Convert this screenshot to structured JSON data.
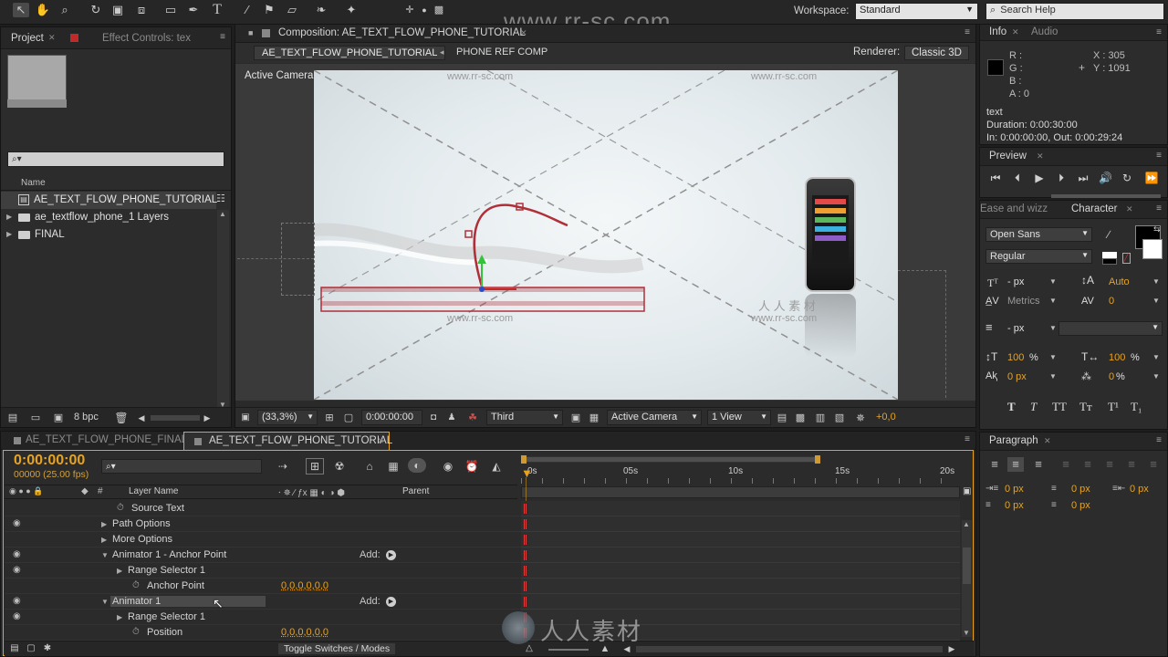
{
  "toolbar": {
    "workspace_label": "Workspace:",
    "workspace_value": "Standard",
    "search_placeholder": "Search Help"
  },
  "watermark": "www.rr-sc.com",
  "project_panel": {
    "tab_project": "Project",
    "tab_effect_controls": "Effect Controls: tex",
    "column_name": "Name",
    "items": [
      {
        "label": "AE_TEXT_FLOW_PHONE_TUTORIAL",
        "type": "composition"
      },
      {
        "label": "ae_textflow_phone_1 Layers",
        "type": "folder"
      },
      {
        "label": "FINAL",
        "type": "folder"
      }
    ],
    "bpc": "8 bpc"
  },
  "composition_panel": {
    "tab_title": "Composition: AE_TEXT_FLOW_PHONE_TUTORIAL",
    "breadcrumb_current": "AE_TEXT_FLOW_PHONE_TUTORIAL",
    "breadcrumb_next": "PHONE REF COMP",
    "renderer_label": "Renderer:",
    "renderer_value": "Classic 3D",
    "active_camera_label": "Active Camera",
    "viewer_watermarks": [
      "www.rr-sc.com",
      "www.rr-sc.com",
      "www.rr-sc.com",
      "www.rr-sc.com",
      "人 人 素 材"
    ],
    "footer": {
      "zoom": "(33,3%)",
      "timecode": "0:00:00:00",
      "resolution": "Third",
      "view": "Active Camera",
      "views_count": "1 View",
      "exposure": "+0,0"
    }
  },
  "info_panel": {
    "tab_info": "Info",
    "tab_audio": "Audio",
    "r": "R :",
    "g": "G :",
    "b": "B :",
    "a": "A : 0",
    "x": "X : 305",
    "y": "Y : 1091",
    "layer_name": "text",
    "duration": "Duration: 0:00:30:00",
    "in_out": "In: 0:00:00:00, Out: 0:00:29:24"
  },
  "preview_panel": {
    "title": "Preview"
  },
  "character_panel": {
    "tab_ease": "Ease and wizz",
    "tab_character": "Character",
    "font_family": "Open Sans",
    "font_style": "Regular",
    "font_size": "- px",
    "leading": "Auto",
    "kerning": "Metrics",
    "tracking": "0",
    "stroke_width": "- px",
    "vert_scale": "100",
    "horiz_scale": "100",
    "baseline_shift": "0 px",
    "tsume": "0",
    "percent": "%",
    "text_style_buttons": [
      "T",
      "T",
      "TT",
      "Tт",
      "T¹",
      "T₁"
    ]
  },
  "paragraph_panel": {
    "title": "Paragraph",
    "indent_left": "0 px",
    "indent_first": "0 px",
    "indent_right": "0 px",
    "space_before": "0 px",
    "space_after": "0 px"
  },
  "timeline_panel": {
    "tab_final": "AE_TEXT_FLOW_PHONE_FINAL",
    "tab_tutorial": "AE_TEXT_FLOW_PHONE_TUTORIAL",
    "timecode": "0:00:00:00",
    "frame_info": "00000 (25.00 fps)",
    "col_layer_name": "Layer Name",
    "col_parent": "Parent",
    "col_hash": "#",
    "ruler": [
      "0s",
      "05s",
      "10s",
      "15s",
      "20s"
    ],
    "toggle_label": "Toggle Switches / Modes",
    "rows": [
      {
        "label": "Source Text",
        "indent": 1,
        "stopwatch": true,
        "eye": false,
        "twirl": "",
        "value": "",
        "add": false
      },
      {
        "label": "Path Options",
        "indent": 0,
        "stopwatch": false,
        "eye": true,
        "twirl": "closed",
        "value": "",
        "add": false
      },
      {
        "label": "More Options",
        "indent": 0,
        "stopwatch": false,
        "eye": false,
        "twirl": "closed",
        "value": "",
        "add": false
      },
      {
        "label": "Animator 1 - Anchor Point",
        "indent": 0,
        "stopwatch": false,
        "eye": true,
        "twirl": "open",
        "value": "",
        "add": true
      },
      {
        "label": "Range Selector 1",
        "indent": 1,
        "stopwatch": false,
        "eye": true,
        "twirl": "closed",
        "value": "",
        "add": false
      },
      {
        "label": "Anchor Point",
        "indent": 2,
        "stopwatch": true,
        "eye": false,
        "twirl": "",
        "value": "0,0,0,0,0,0",
        "add": false
      },
      {
        "label": "Animator 1",
        "indent": 0,
        "stopwatch": false,
        "eye": true,
        "twirl": "open",
        "value": "",
        "add": true,
        "selected": true
      },
      {
        "label": "Range Selector 1",
        "indent": 1,
        "stopwatch": false,
        "eye": true,
        "twirl": "closed",
        "value": "",
        "add": false
      },
      {
        "label": "Position",
        "indent": 2,
        "stopwatch": true,
        "eye": false,
        "twirl": "",
        "value": "0,0,0,0,0,0",
        "add": false
      }
    ],
    "add_label": "Add:"
  },
  "colors": {
    "accent": "#e8a31e",
    "panel": "#2c2c2c",
    "viewer_bg": "#3a3a3a",
    "path": "#b0303a"
  }
}
